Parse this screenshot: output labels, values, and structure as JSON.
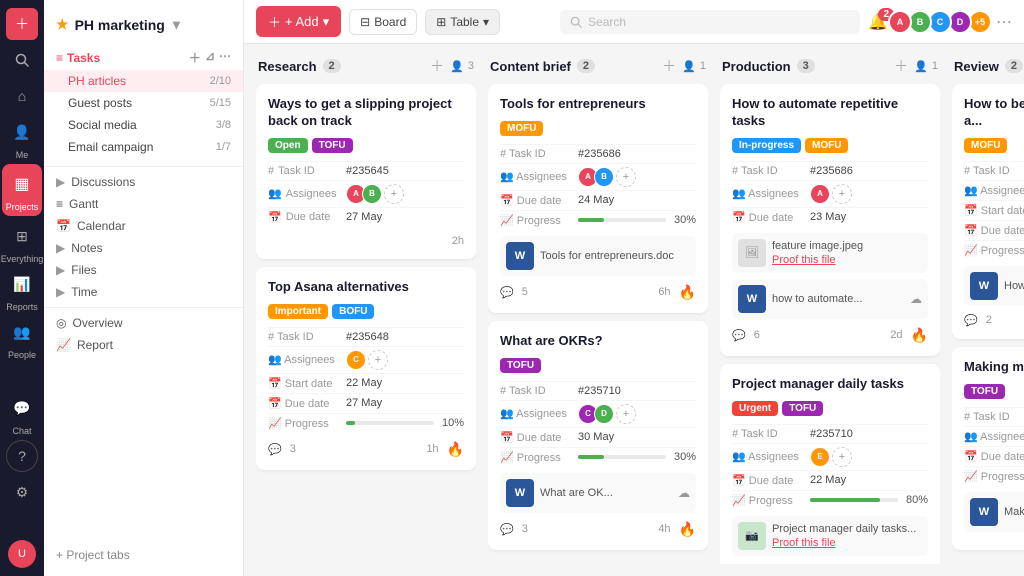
{
  "app": {
    "project_name": "PH marketing",
    "chevron": "▾"
  },
  "left_sidebar": {
    "icons": [
      {
        "name": "plus-icon",
        "symbol": "+",
        "active": true
      },
      {
        "name": "search-icon",
        "symbol": "🔍"
      },
      {
        "name": "home-icon",
        "symbol": "⌂"
      },
      {
        "name": "me-icon",
        "symbol": "👤",
        "label": "Me"
      },
      {
        "name": "projects-icon",
        "symbol": "▦",
        "label": "Projects",
        "active": true
      },
      {
        "name": "everything-icon",
        "symbol": "⊞",
        "label": "Everything"
      },
      {
        "name": "reports-icon",
        "symbol": "📊",
        "label": "Reports"
      },
      {
        "name": "people-icon",
        "symbol": "👥",
        "label": "People"
      },
      {
        "name": "chat-icon",
        "symbol": "💬",
        "label": "Chat"
      },
      {
        "name": "help-icon",
        "symbol": "?"
      },
      {
        "name": "settings-icon",
        "symbol": "⚙"
      }
    ]
  },
  "nav_sidebar": {
    "tasks_label": "Tasks",
    "items": [
      {
        "label": "PH articles",
        "count": "2/10",
        "active": true
      },
      {
        "label": "Guest posts",
        "count": "5/15"
      },
      {
        "label": "Social media",
        "count": "3/8"
      },
      {
        "label": "Email campaign",
        "count": "1/7"
      }
    ],
    "discussions_label": "Discussions",
    "gantt_label": "Gantt",
    "calendar_label": "Calendar",
    "notes_label": "Notes",
    "files_label": "Files",
    "time_label": "Time",
    "overview_label": "Overview",
    "report_label": "Report",
    "add_tabs_label": "+ Project tabs"
  },
  "topbar": {
    "add_label": "+ Add",
    "board_label": "Board",
    "table_label": "Table",
    "search_placeholder": "Search",
    "notification_count": "2",
    "extra_users": "+5"
  },
  "columns": [
    {
      "id": "research",
      "title": "Research",
      "count": "2",
      "user_count": "3",
      "cards": [
        {
          "id": "card-r1",
          "title": "Ways to get a slipping project back on track",
          "tags": [
            {
              "label": "Open",
              "type": "open"
            },
            {
              "label": "TOFU",
              "type": "tofu"
            }
          ],
          "task_id": "#235645",
          "assignees": [
            "#e8445a",
            "#4caf50"
          ],
          "due_date": "27 May",
          "time": "2h",
          "comments": null
        },
        {
          "id": "card-r2",
          "title": "Top Asana alternatives",
          "tags": [
            {
              "label": "Important",
              "type": "important"
            },
            {
              "label": "BOFU",
              "type": "bofu"
            }
          ],
          "task_id": "#235648",
          "assignees": [
            "#ff9800"
          ],
          "start_date": "22 May",
          "due_date": "27 May",
          "progress": "10%",
          "progress_val": 10,
          "time": "1h",
          "comments": 3
        }
      ]
    },
    {
      "id": "content-brief",
      "title": "Content brief",
      "count": "2",
      "user_count": "1",
      "cards": [
        {
          "id": "card-cb1",
          "title": "Tools for entrepreneurs",
          "tags": [
            {
              "label": "MOFU",
              "type": "mofu"
            }
          ],
          "task_id": "#235686",
          "assignees": [
            "#e8445a",
            "#2196f3"
          ],
          "due_date": "24 May",
          "progress": "30%",
          "progress_val": 30,
          "file_name": "Tools for entrepreneurs.doc",
          "file_type": "word",
          "time": "6h",
          "comments": 5
        },
        {
          "id": "card-cb2",
          "title": "What are OKRs?",
          "tags": [
            {
              "label": "TOFU",
              "type": "tofu"
            }
          ],
          "task_id": "#235710",
          "assignees": [
            "#9c27b0",
            "#4caf50"
          ],
          "due_date": "30 May",
          "progress": "30%",
          "progress_val": 30,
          "file_name": "What are OK...",
          "file_type": "word",
          "time": "4h",
          "comments": 3
        }
      ]
    },
    {
      "id": "production",
      "title": "Production",
      "count": "3",
      "user_count": "1",
      "cards": [
        {
          "id": "card-p1",
          "title": "How to automate repetitive tasks",
          "tags": [
            {
              "label": "In-progress",
              "type": "inprogress"
            },
            {
              "label": "MOFU",
              "type": "mofu"
            }
          ],
          "task_id": "#235686",
          "assignees": [
            "#e8445a"
          ],
          "due_date": "23 May",
          "file1_name": "feature image.jpeg",
          "file1_link": "Proof this file",
          "file2_name": "how to automate...",
          "time": "2d",
          "comments": 6
        },
        {
          "id": "card-p2",
          "title": "Project manager daily tasks",
          "tags": [
            {
              "label": "Urgent",
              "type": "urgent"
            },
            {
              "label": "TOFU",
              "type": "tofu"
            }
          ],
          "task_id": "#235710",
          "assignees": [
            "#ff9800"
          ],
          "due_date": "22 May",
          "progress": "80%",
          "progress_val": 80,
          "file_name": "Project manager daily tasks...",
          "file_link": "Proof this file"
        }
      ]
    },
    {
      "id": "review",
      "title": "Review",
      "count": "2",
      "cards": [
        {
          "id": "card-rv1",
          "title": "How to better h... deadlines as a...",
          "tags": [
            {
              "label": "MOFU",
              "type": "mofu"
            }
          ],
          "comments": 2,
          "file_name": "How to..."
        },
        {
          "id": "card-rv2",
          "title": "Making mistake...",
          "tags": [
            {
              "label": "TOFU",
              "type": "tofu"
            }
          ]
        }
      ]
    }
  ],
  "sidebar_bottom_label": "0 Chat"
}
